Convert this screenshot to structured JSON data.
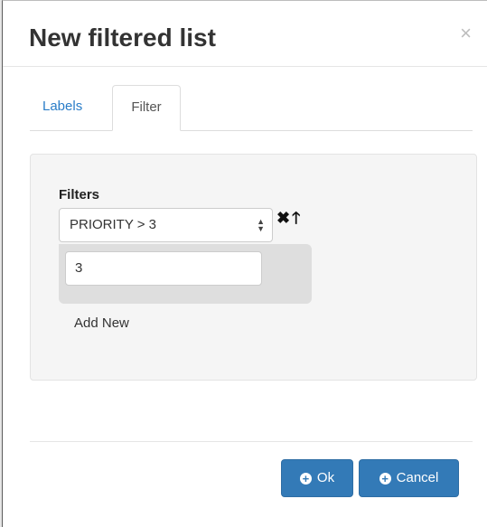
{
  "dialog": {
    "title": "New filtered list",
    "close_glyph": "×"
  },
  "tabs": [
    {
      "label": "Labels",
      "active": false
    },
    {
      "label": "Filter",
      "active": true
    }
  ],
  "filters": {
    "heading": "Filters",
    "selected_option": "PRIORITY > 3",
    "value": "3",
    "add_new_label": "Add New",
    "icons": {
      "remove": "close-icon",
      "move_up": "arrow-up-icon"
    }
  },
  "footer": {
    "ok_label": "Ok",
    "cancel_label": "Cancel"
  },
  "colors": {
    "primary": "#337ab7",
    "link": "#2a7dc8"
  }
}
